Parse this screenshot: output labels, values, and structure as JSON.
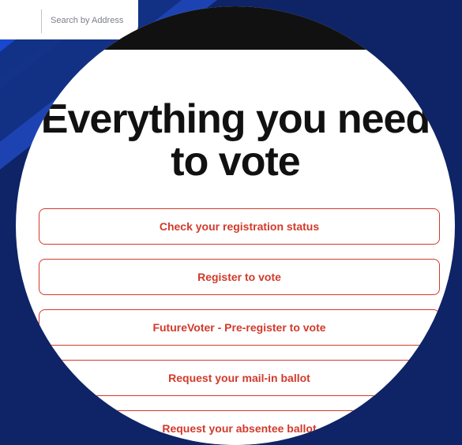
{
  "search": {
    "placeholder": "Search by Address"
  },
  "hero": {
    "title_line1": "Everything you need",
    "title_line2": "to vote"
  },
  "actions": [
    {
      "label": "Check your registration status"
    },
    {
      "label": "Register to vote"
    },
    {
      "label": "FutureVoter - Pre-register to vote"
    },
    {
      "label": "Request your mail-in ballot"
    },
    {
      "label": "Request your absentee ballot"
    }
  ],
  "colors": {
    "accent": "#d23a2a",
    "background": "#0e2466",
    "stripe": "#1a4ad6",
    "topbar": "#111111"
  }
}
